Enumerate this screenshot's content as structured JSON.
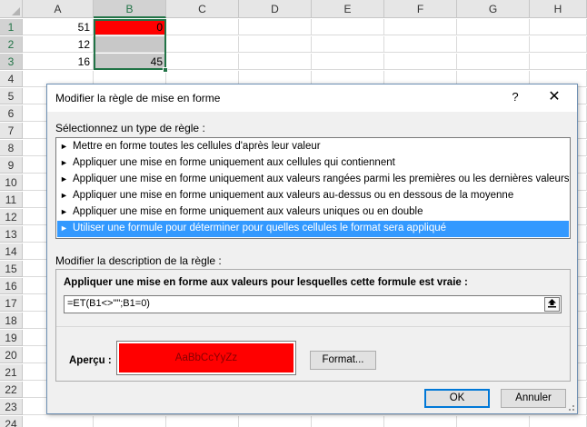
{
  "sheet": {
    "columns": [
      "A",
      "B",
      "C",
      "D",
      "E",
      "F",
      "G",
      "H"
    ],
    "rows": [
      "1",
      "2",
      "3",
      "4",
      "5",
      "6",
      "7",
      "8",
      "9",
      "10",
      "11",
      "12",
      "13",
      "14",
      "15",
      "16",
      "17",
      "18",
      "19",
      "20",
      "21",
      "22",
      "23",
      "24"
    ],
    "cells": {
      "A1": "51",
      "B1": "0",
      "A2": "12",
      "B2": "",
      "A3": "16",
      "B3": "45"
    },
    "highlight_color": "#ff0000",
    "neutral_fill": "#c8c8c8",
    "selection_color": "#217346"
  },
  "dialog": {
    "title": "Modifier la règle de mise en forme",
    "help_glyph": "?",
    "close_glyph": "✕",
    "select_type_label": "Sélectionnez un type de règle :",
    "rule_types": [
      "Mettre en forme toutes les cellules d'après leur valeur",
      "Appliquer une mise en forme uniquement aux cellules qui contiennent",
      "Appliquer une mise en forme uniquement aux valeurs rangées parmi les premières ou les dernières valeurs",
      "Appliquer une mise en forme uniquement aux valeurs au-dessus ou en dessous de la moyenne",
      "Appliquer une mise en forme uniquement aux valeurs uniques ou en double",
      "Utiliser une formule pour déterminer pour quelles cellules le format sera appliqué"
    ],
    "selected_rule_index": 5,
    "description_label": "Modifier la description de la règle :",
    "formula_label": "Appliquer une mise en forme aux valeurs pour lesquelles cette formule est vraie :",
    "formula_value": "=ET(B1<>\"\";B1=0)",
    "preview_label": "Aperçu :",
    "preview_text": "AaBbCcYyZz",
    "preview_fill": "#ff0000",
    "format_button": "Format...",
    "ok_button": "OK",
    "cancel_button": "Annuler"
  }
}
